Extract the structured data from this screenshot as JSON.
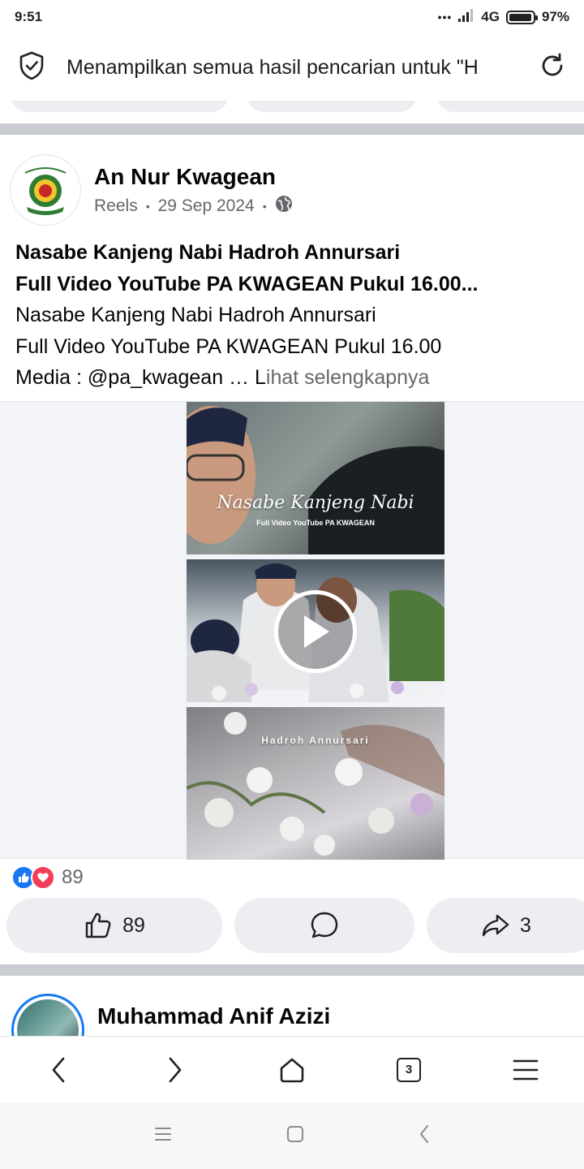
{
  "status_bar": {
    "time": "9:51",
    "signal_dots": "•••",
    "network": "4G",
    "battery": "97%",
    "battery_level": 0.97
  },
  "address_bar": {
    "text": "Menampilkan semua hasil pencarian untuk \"H",
    "shield_icon": "shield-check-icon",
    "reload_icon": "reload-icon"
  },
  "post": {
    "page_name": "An Nur Kwagean",
    "type": "Reels",
    "date": "29 Sep 2024",
    "privacy_icon": "globe-icon",
    "title": "Nasabe Kanjeng Nabi Hadroh Annursari\nFull Video YouTube PA KWAGEAN Pukul 16.00...",
    "body": "Nasabe Kanjeng Nabi Hadroh Annursari\nFull Video YouTube PA KWAGEAN Pukul 16.00\nMedia : @pa_kwagean … L",
    "see_more": "ihat selengkapnya",
    "video": {
      "frame1_title": "Nasabe Kanjeng Nabi",
      "frame1_subtitle": "Full Video YouTube PA KWAGEAN",
      "frame3_title": "Hadroh Annursari"
    },
    "reaction_count": "89",
    "actions": {
      "like_count": "89",
      "share_count": "3"
    }
  },
  "next_post": {
    "name": "Muhammad Anif Azizi"
  },
  "browser_nav": {
    "tab_count": "3"
  },
  "colors": {
    "facebook_blue": "#1877f2",
    "love_red": "#f33e58",
    "secondary_text": "#65676b",
    "divider": "#c9ccd1"
  }
}
